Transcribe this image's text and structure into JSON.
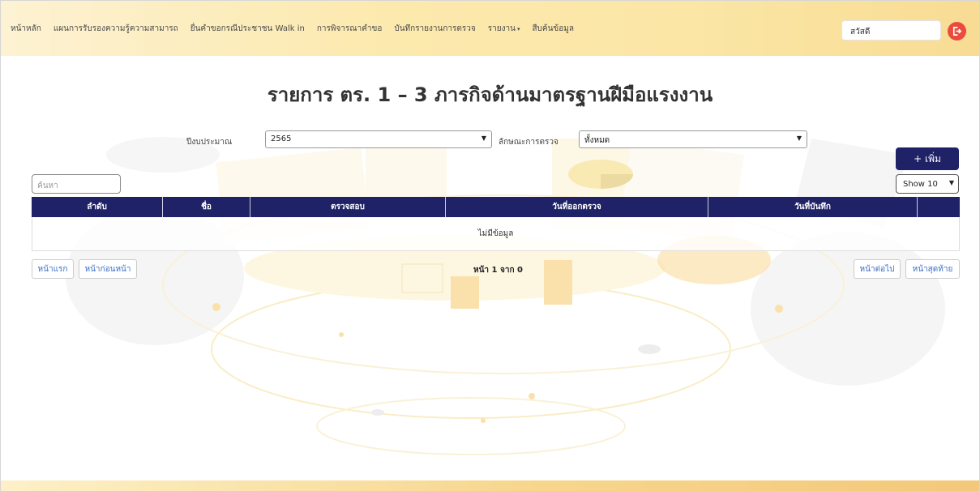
{
  "nav": {
    "items": [
      "หน้าหลัก",
      "แผนการรับรองความรู้ความสามารถ",
      "ยื่นคำขอกรณีประชาชน Walk in",
      "การพิจารณาคำขอ",
      "บันทึกรายงานการตรวจ",
      "รายงาน",
      "สืบค้นข้อมูล"
    ],
    "report_caret": "▾",
    "greeting": "สวัสดี"
  },
  "page": {
    "title": "รายการ ตร. 1 – 3 ภารกิจด้านมาตรฐานฝีมือแรงงาน"
  },
  "filters": {
    "year_label": "ปีงบประมาณ",
    "year_value": "2565",
    "type_label": "ลักษณะการตรวจ",
    "type_value": "ทั้งหมด"
  },
  "actions": {
    "add_label": "+ เพิ่ม",
    "search_placeholder": "ค้นหา",
    "show_value": "Show 10"
  },
  "table": {
    "headers": [
      "ลำดับ",
      "ชื่อ",
      "ตรวจสอบ",
      "วันที่ออกตรวจ",
      "วันที่บันทึก",
      ""
    ],
    "empty_text": "ไม่มีข้อมูล"
  },
  "pagination": {
    "first": "หน้าแรก",
    "prev": "หน้าก่อนหน้า",
    "info": "หน้า 1 จาก 0",
    "next": "หน้าต่อไป",
    "last": "หน้าสุดท้าย"
  }
}
